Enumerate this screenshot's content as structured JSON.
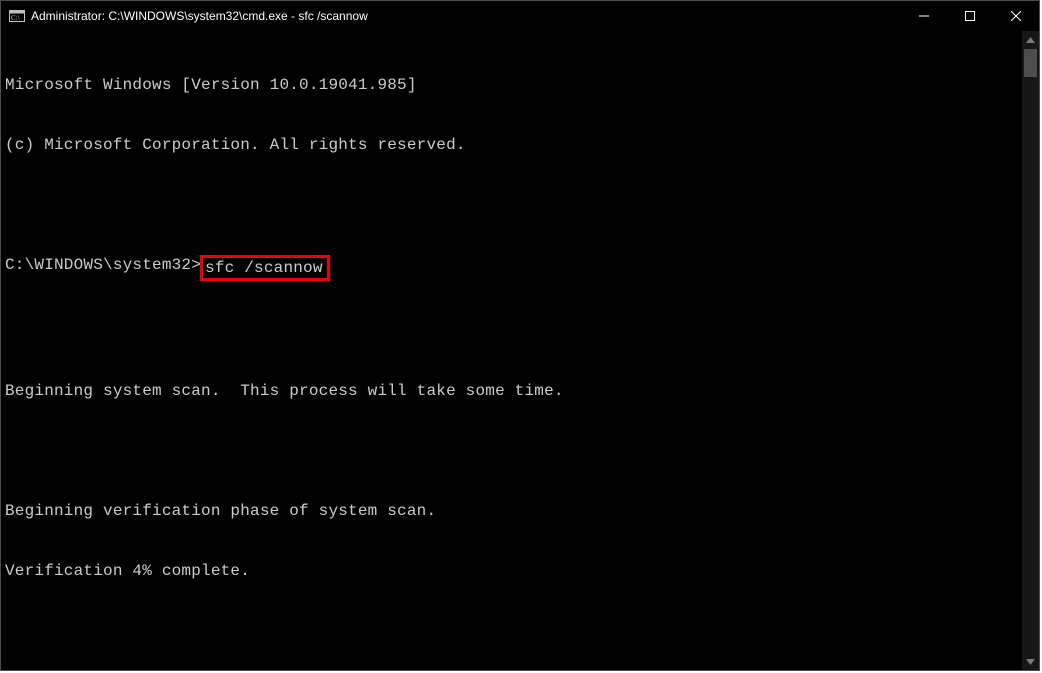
{
  "window": {
    "title": "Administrator: C:\\WINDOWS\\system32\\cmd.exe - sfc  /scannow"
  },
  "terminal": {
    "lines": [
      "Microsoft Windows [Version 10.0.19041.985]",
      "(c) Microsoft Corporation. All rights reserved."
    ],
    "prompt": "C:\\WINDOWS\\system32>",
    "command": "sfc /scannow",
    "after": [
      "Beginning system scan.  This process will take some time.",
      "",
      "Beginning verification phase of system scan.",
      "Verification 4% complete."
    ]
  }
}
